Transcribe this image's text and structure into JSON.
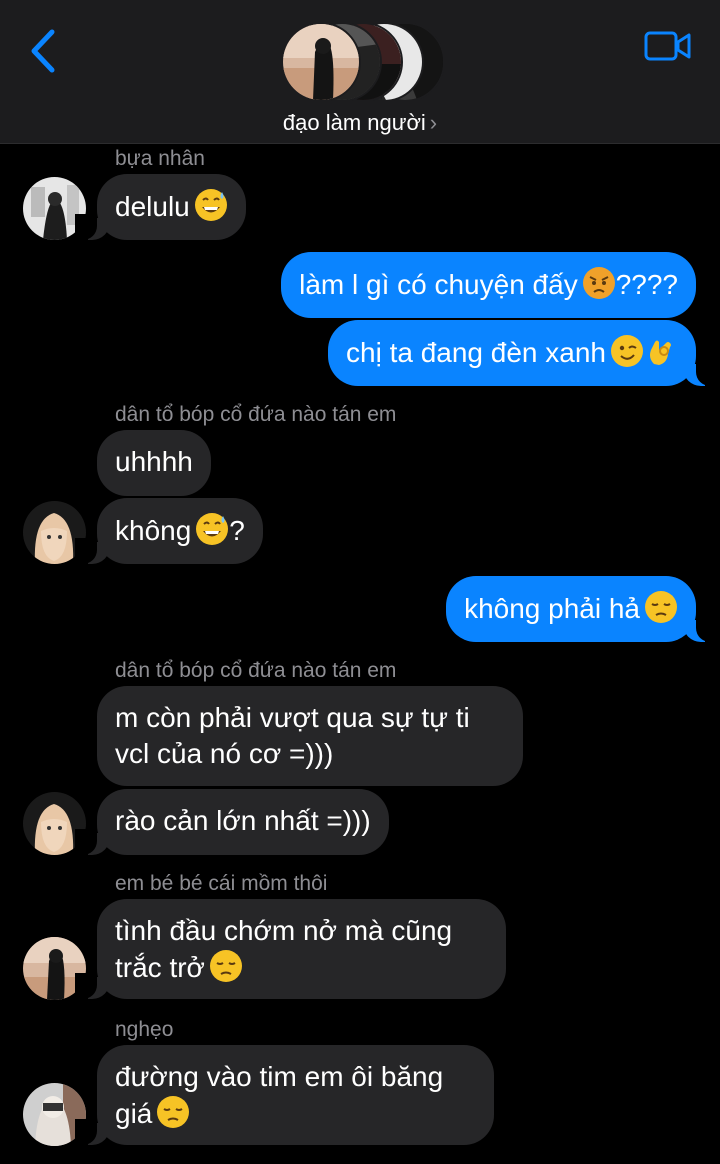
{
  "header": {
    "group_name": "đạo làm người",
    "chevron": "›",
    "back_icon": "chevron-left-icon",
    "video_icon": "video-camera-icon",
    "accent": "#0a84ff"
  },
  "messages": [
    {
      "sender": "bựa nhân",
      "text": "delulu",
      "emoji": "grinning-sweat-emoji"
    },
    {
      "text": "làm l gì có chuyện đấy",
      "emoji": "angry-emoji",
      "suffix": "????"
    },
    {
      "text": "chị ta đang đèn xanh",
      "emoji": "wink-ok-emoji"
    },
    {
      "sender": "dân tổ bóp cổ đứa nào tán em",
      "text": "uhhhh"
    },
    {
      "text": "không",
      "emoji": "grinning-sweat-emoji",
      "suffix": "?"
    },
    {
      "text": "không phải hả",
      "emoji": "pensive-emoji"
    },
    {
      "sender": "dân tổ bóp cổ đứa nào tán em",
      "line1": "m còn phải vượt qua sự tự ti",
      "line2": "vcl của nó cơ =)))"
    },
    {
      "text": "rào cản lớn nhất =)))"
    },
    {
      "sender": "em bé bé cái mồm thôi",
      "line1": "tình đầu chớm nở mà cũng",
      "line2": "trắc trở",
      "emoji": "pensive-emoji"
    },
    {
      "sender": "nghẹo",
      "line1": "đường vào tim em ôi băng",
      "line2": "giá",
      "emoji": "pensive-emoji"
    }
  ],
  "colors": {
    "incoming": "#262628",
    "outgoing": "#0a84ff",
    "background": "#000000"
  }
}
